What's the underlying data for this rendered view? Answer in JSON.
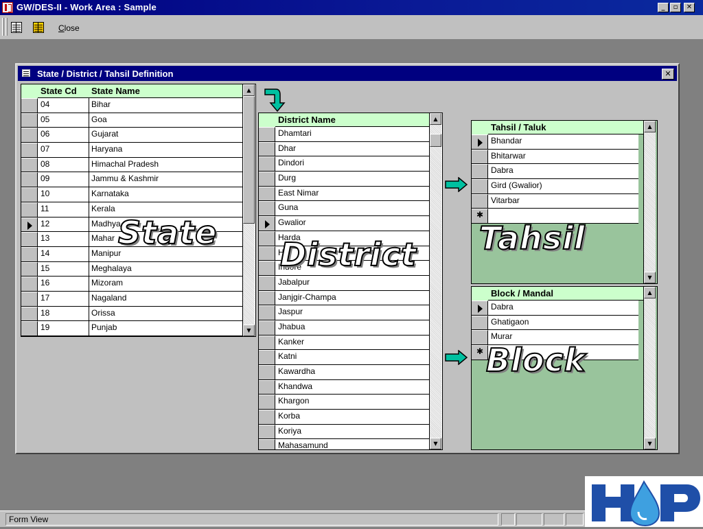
{
  "window": {
    "title": "GW/DES-II - Work Area : Sample"
  },
  "window_buttons": {
    "minimize": "_",
    "restore": "▫",
    "close": "✕"
  },
  "toolbar": {
    "close_label_underlined": "C",
    "close_label_rest": "lose"
  },
  "form": {
    "title": "State / District / Tahsil Definition"
  },
  "state_grid": {
    "col_code_header": "State Cd",
    "col_name_header": "State Name",
    "current_row_index": 8,
    "rows": [
      {
        "code": "04",
        "name": "Bihar"
      },
      {
        "code": "05",
        "name": "Goa"
      },
      {
        "code": "06",
        "name": "Gujarat"
      },
      {
        "code": "07",
        "name": "Haryana"
      },
      {
        "code": "08",
        "name": "Himachal Pradesh"
      },
      {
        "code": "09",
        "name": "Jammu & Kashmir"
      },
      {
        "code": "10",
        "name": "Karnataka"
      },
      {
        "code": "11",
        "name": "Kerala"
      },
      {
        "code": "12",
        "name": "Madhya"
      },
      {
        "code": "13",
        "name": "Mahar"
      },
      {
        "code": "14",
        "name": "Manipur"
      },
      {
        "code": "15",
        "name": "Meghalaya"
      },
      {
        "code": "16",
        "name": "Mizoram"
      },
      {
        "code": "17",
        "name": "Nagaland"
      },
      {
        "code": "18",
        "name": "Orissa"
      },
      {
        "code": "19",
        "name": "Punjab"
      }
    ]
  },
  "district_grid": {
    "header": "District Name",
    "current_row_index": 6,
    "rows": [
      "Dhamtari",
      "Dhar",
      "Dindori",
      "Durg",
      "East Nimar",
      "Guna",
      "Gwalior",
      "Harda",
      "H",
      "Indore",
      "Jabalpur",
      "Janjgir-Champa",
      "Jaspur",
      "Jhabua",
      "Kanker",
      "Katni",
      "Kawardha",
      "Khandwa",
      "Khargon",
      "Korba",
      "Koriya",
      "Mahasamund"
    ]
  },
  "tahsil_grid": {
    "header": "Tahsil / Taluk",
    "current_row_index": 0,
    "rows": [
      "Bhandar",
      "Bhitarwar",
      "Dabra",
      "Gird (Gwalior)",
      "Vitarbar"
    ]
  },
  "block_grid": {
    "header": "Block / Mandal",
    "current_row_index": 0,
    "rows": [
      "Dabra",
      "Ghatigaon",
      "Murar"
    ]
  },
  "overlays": {
    "state": "State",
    "district": "District",
    "tahsil": "Tahsil",
    "block": "Block"
  },
  "statusbar": {
    "text": "Form View"
  },
  "colors": {
    "title_bar": "#000080",
    "header_green": "#ccffcc",
    "panel_green": "#99c49c",
    "arrow_teal": "#00c0a0"
  },
  "icons": [
    "app-icon",
    "form-view-icon",
    "datasheet-view-icon",
    "form-icon",
    "current-record-icon",
    "new-record-icon",
    "curved-arrow-icon",
    "right-arrow-icon",
    "hp-logo"
  ]
}
